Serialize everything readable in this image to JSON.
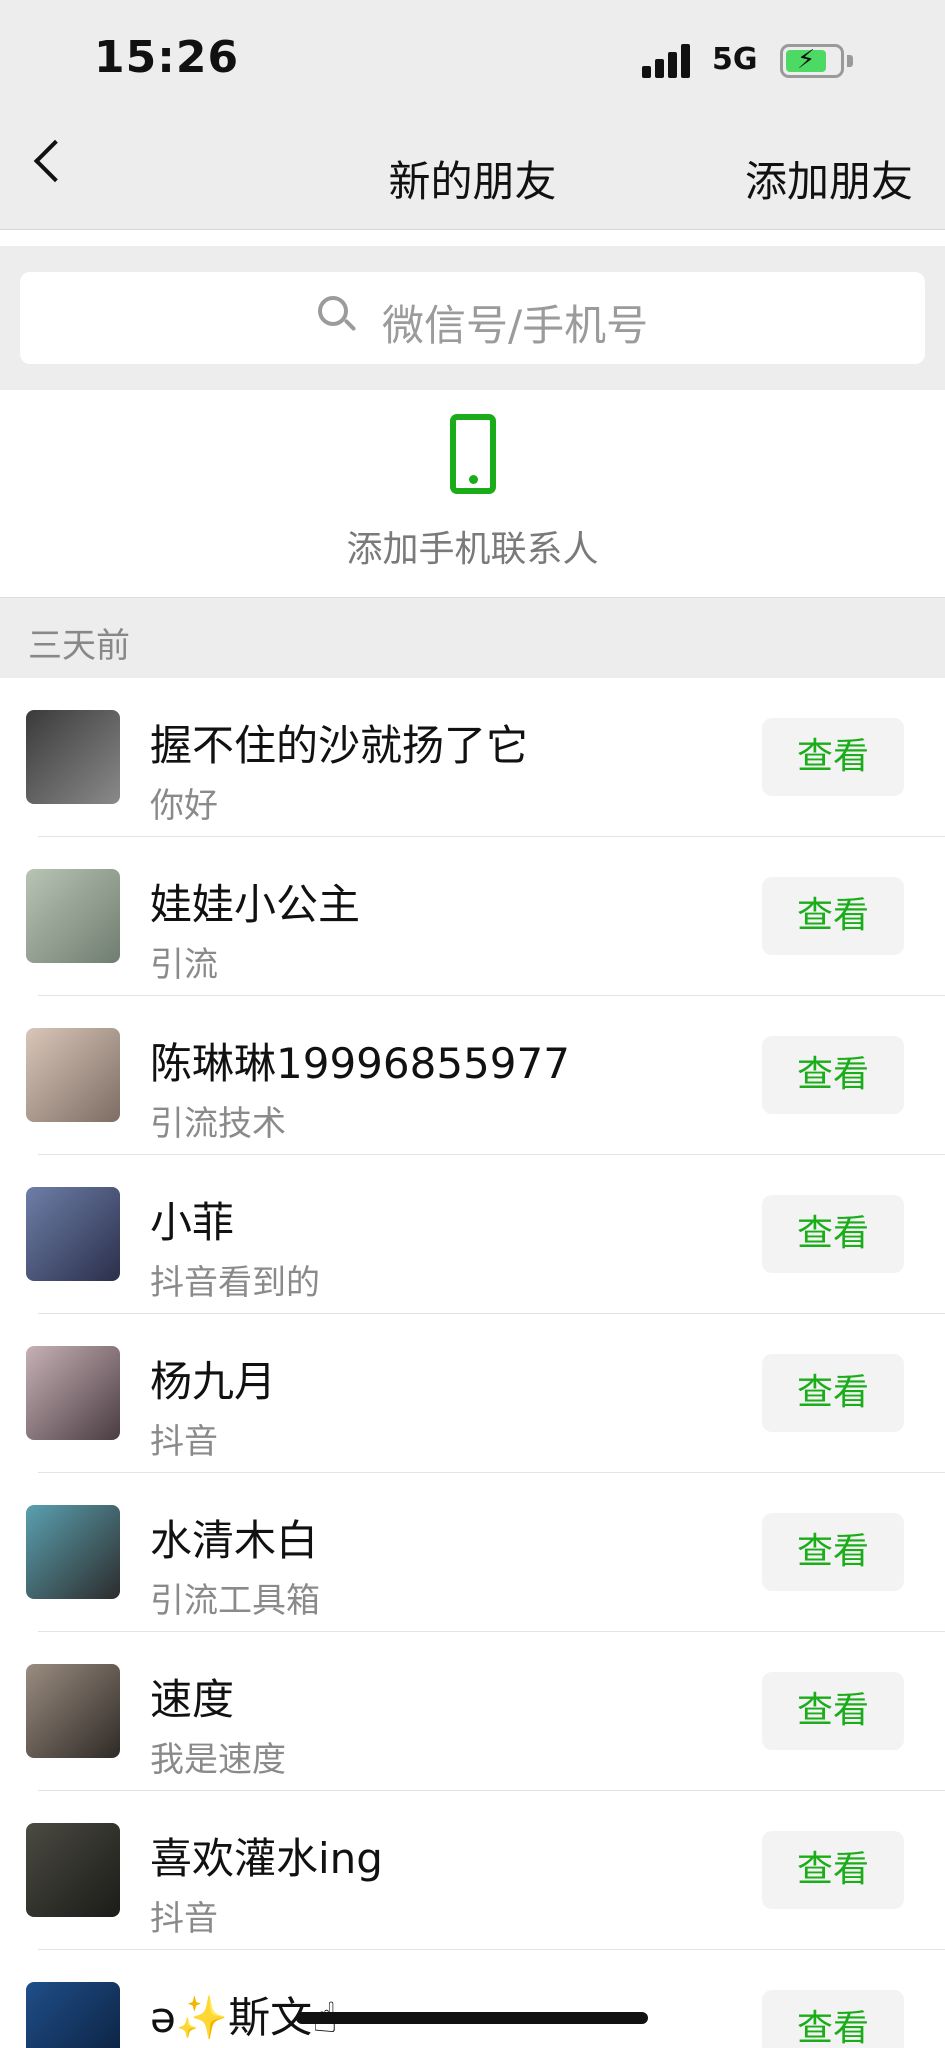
{
  "status_bar": {
    "time": "15:26",
    "network": "5G"
  },
  "nav": {
    "title": "新的朋友",
    "action_label": "添加朋友"
  },
  "search": {
    "placeholder": "微信号/手机号"
  },
  "phone_contacts": {
    "label": "添加手机联系人"
  },
  "section": {
    "header": "三天前"
  },
  "view_label": "查看",
  "friends": [
    {
      "name": "握不住的沙就扬了它",
      "message": "你好",
      "avatar_colors": [
        "#3a3a3a",
        "#8a8a8a"
      ]
    },
    {
      "name": "娃娃小公主",
      "message": "引流",
      "avatar_colors": [
        "#b8c4b4",
        "#6f7d70"
      ]
    },
    {
      "name": "陈琳琳19996855977",
      "message": "引流技术",
      "avatar_colors": [
        "#d9c6b9",
        "#7d6d63"
      ]
    },
    {
      "name": "小菲",
      "message": "抖音看到的",
      "avatar_colors": [
        "#6d7ea8",
        "#2b2f4a"
      ]
    },
    {
      "name": "杨九月",
      "message": "抖音",
      "avatar_colors": [
        "#c6b1b5",
        "#4a3c42"
      ]
    },
    {
      "name": "水清木白",
      "message": "引流工具箱",
      "avatar_colors": [
        "#5aa0b0",
        "#2c2c2c"
      ]
    },
    {
      "name": "速度",
      "message": "我是速度",
      "avatar_colors": [
        "#9a8c80",
        "#2f2a26"
      ]
    },
    {
      "name": "喜欢灌水ing",
      "message": "抖音",
      "avatar_colors": [
        "#4b4b42",
        "#1b1b18"
      ]
    },
    {
      "name": "ə✨斯文☝",
      "message": "",
      "avatar_colors": [
        "#1f4f8a",
        "#0a1d3a"
      ]
    }
  ]
}
